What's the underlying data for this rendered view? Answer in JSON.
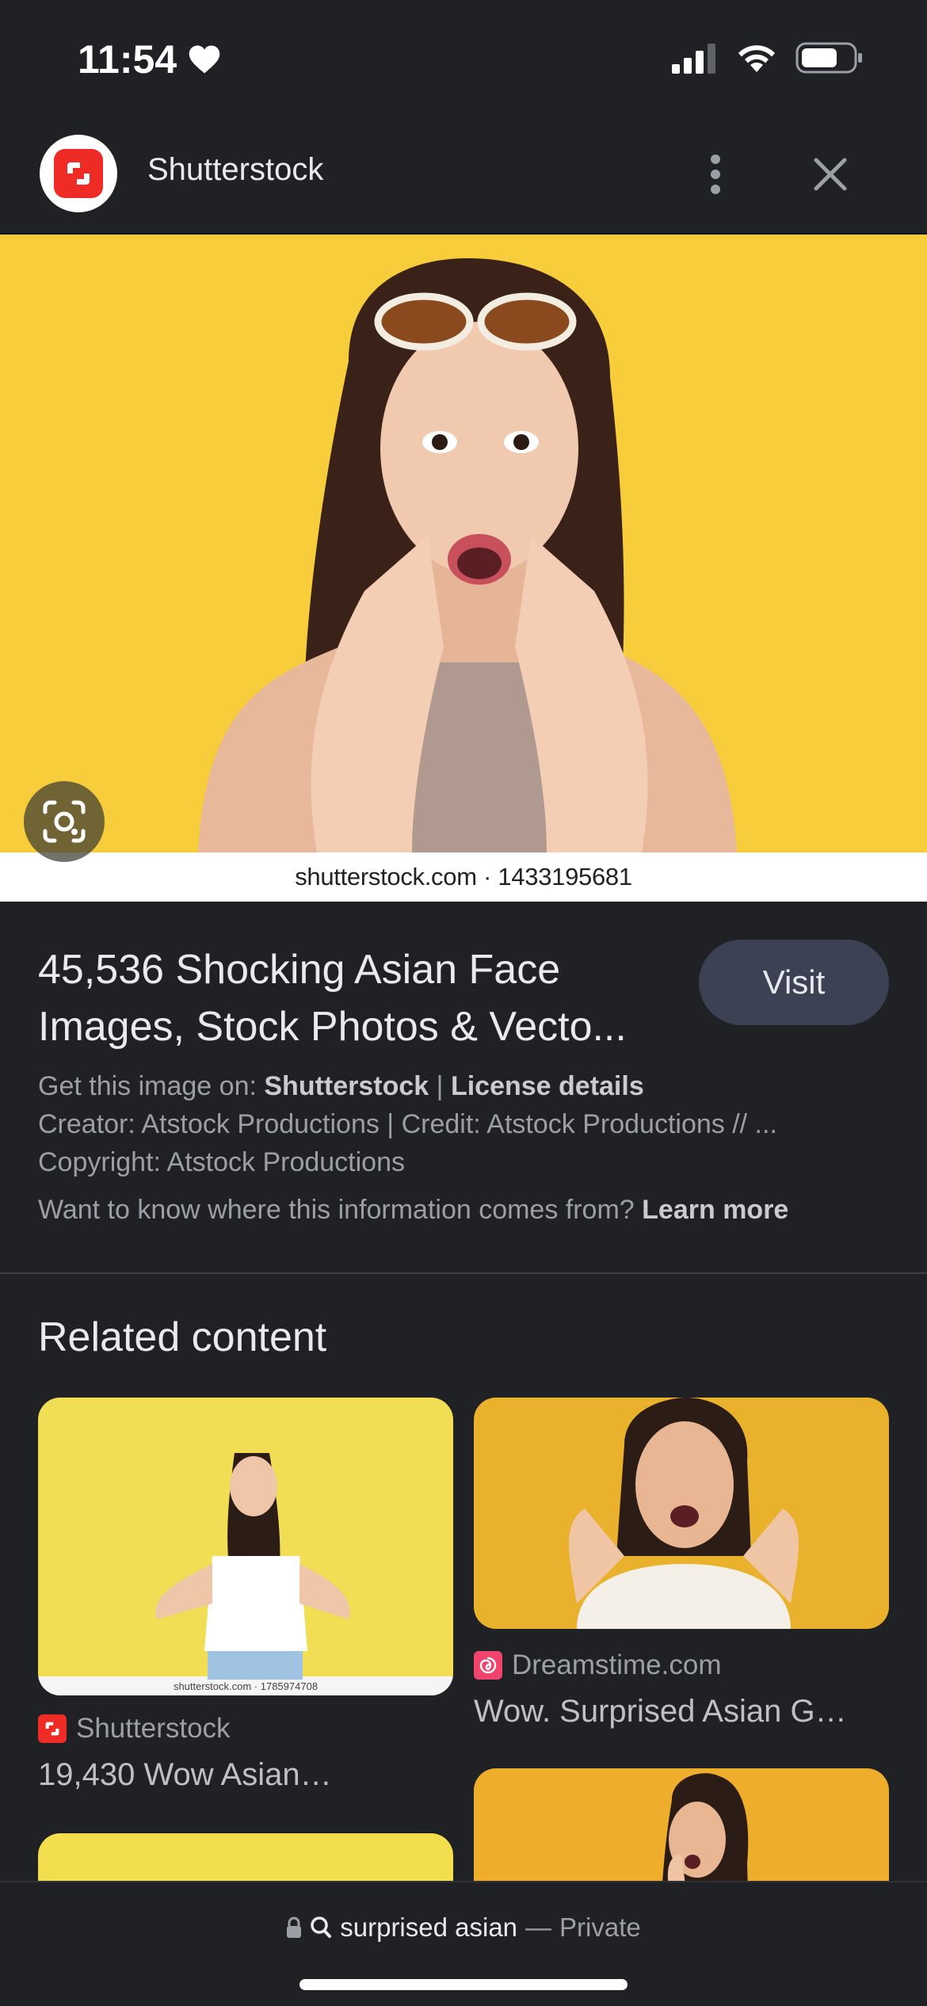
{
  "status_bar": {
    "time": "11:54",
    "icons": [
      "heart-icon",
      "signal-icon",
      "wifi-icon",
      "battery-icon"
    ]
  },
  "header": {
    "site_name": "Shutterstock",
    "icons": [
      "shutterstock-logo-icon",
      "more-vert-icon",
      "close-icon"
    ]
  },
  "hero": {
    "caption": "shutterstock.com · 1433195681",
    "background_color": "#f7cd3c"
  },
  "result": {
    "title": "45,536 Shocking Asian Face Images, Stock Photos & Vecto...",
    "visit_label": "Visit",
    "get_image_prefix": "Get this image on:",
    "get_image_source": "Shutterstock",
    "separator": "|",
    "license_link": "License details",
    "creator_line": "Creator: Atstock Productions | Credit: Atstock Productions // ...",
    "copyright_line": "Copyright: Atstock Productions",
    "info_question": "Want to know where this information comes from?",
    "learn_more": "Learn more"
  },
  "related": {
    "heading": "Related content",
    "cards": [
      {
        "source": "Shutterstock",
        "title": "19,430 Wow Asian…",
        "watermark": "shutterstock.com · 1785974708",
        "background_color": "#f2de55"
      },
      {
        "source": "Dreamstime.com",
        "title": "Wow. Surprised Asian G…",
        "background_color": "#eab12c"
      },
      {
        "background_color": "#f3de4e"
      },
      {
        "background_color": "#eeae2c"
      }
    ]
  },
  "bottom_bar": {
    "query": "surprised asian",
    "dash": "—",
    "mode": "Private"
  },
  "colors": {
    "background": "#202124",
    "visit_button": "#3c4254",
    "shutterstock_red": "#ee2b24",
    "dreamstime_pink": "#f0436d"
  }
}
